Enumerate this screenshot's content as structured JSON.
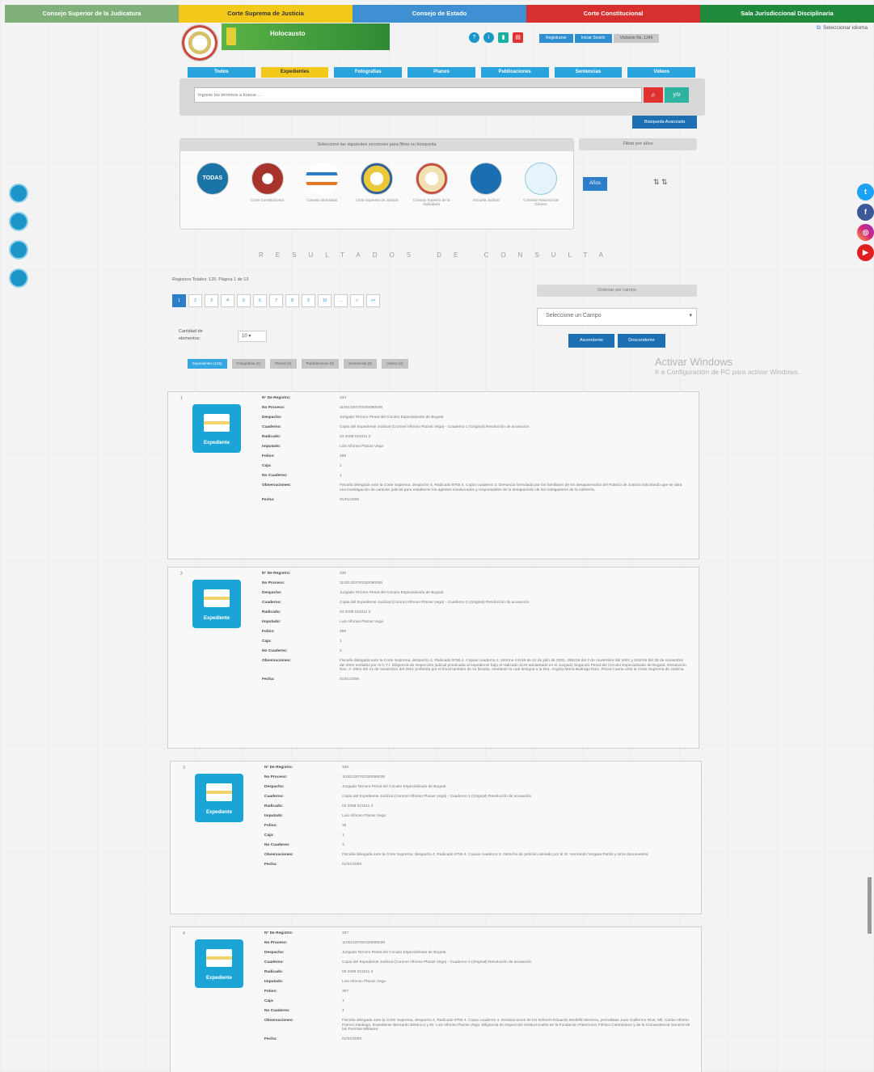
{
  "topbar": [
    {
      "label": "Consejo Superior de la Judicatura",
      "color": "#7fb07a"
    },
    {
      "label": "Corte Suprema de Justicia",
      "color": "#f2c81a",
      "text": "#333"
    },
    {
      "label": "Consejo de Estado",
      "color": "#3f8fd3"
    },
    {
      "label": "Corte Constitucional",
      "color": "#d8302e"
    },
    {
      "label": "Sala Jurisdiccional Disciplinaria",
      "color": "#1f8a3c"
    }
  ],
  "header": {
    "banner_title": "Holocausto",
    "buttons": [
      "Registrarse",
      "Iniciar Sesión"
    ],
    "visitor_count": "Visitante No. 1346",
    "language": "Seleccionar idioma"
  },
  "tabs": [
    "Todos",
    "Expedientes",
    "Fotografías",
    "Planos",
    "Publicaciones",
    "Sentencias",
    "Videos"
  ],
  "search": {
    "placeholder": "Ingrese los términos a buscar ...",
    "button_icon": "search-icon",
    "yo_label": "y/o",
    "advanced_label": "Búsqueda Avanzada"
  },
  "filters": {
    "corp_header": "Seleccione las siguientes secciones para filtrar su búsqueda",
    "corps": [
      {
        "label": "TODAS",
        "color": "#1a74a8"
      },
      {
        "label": "Corte Constitucional",
        "color": "#a8322c"
      },
      {
        "label": "Consejo de Estado",
        "color": "#e9eef5"
      },
      {
        "label": "Corte Suprema de Justicia",
        "color": "#e9c83a"
      },
      {
        "label": "Consejo Superior de la Judicatura",
        "color": "#f0e1b2"
      },
      {
        "label": "Escuela Judicial",
        "color": "#1a6fb2"
      },
      {
        "label": "Comisión Nacional de Género",
        "color": "#e6f3fa"
      }
    ],
    "years_header": "Filtrar por años",
    "years_button": "Años"
  },
  "social": [
    "twitter-icon",
    "facebook-icon",
    "instagram-icon",
    "youtube-icon"
  ],
  "results": {
    "title": "RESULTADOS DE CONSULTA",
    "totals": "Registros Totales: 125. Página 1 de 13",
    "pages": [
      "1",
      "2",
      "3",
      "4",
      "5",
      "6",
      "7",
      "8",
      "9",
      "10",
      "...",
      ">",
      ">>"
    ],
    "order_header": "Ordenar por campo",
    "order_select": "Seleccione un Campo",
    "asc": "Ascendente",
    "desc": "Descendente",
    "cantidad_label": "Cantidad de elementos:",
    "cantidad_value": "10",
    "result_tabs": [
      "Expedientes (125)",
      "Fotografías (0)",
      "Planos (0)",
      "Publicaciones (0)",
      "Sentencias (0)",
      "Videos (0)"
    ],
    "windows_line1": "Activar Windows",
    "windows_line2": "Ir a Configuración de PC para activar Windows.",
    "field_labels": [
      "N° De Registro:",
      "No Proceso:",
      "Despacho:",
      "Cuaderno:",
      "Radicado:",
      "Imputado:",
      "Folios:",
      "Caja:",
      "No Cuaderno:",
      "Observaciones:",
      "Fecha:"
    ],
    "icon_label": "Expediente",
    "items": [
      {
        "num": "1",
        "values": [
          "334",
          "11001320700320090039",
          "Juzgado Tercero Penal del Circuito Especializado de Bogotá",
          "Copia del Expediente Judicial (Coronel Alfonso Plazas Vega) - Cuaderno 1 (Original) Resolución de acusación",
          "03 2008 021011 3",
          "Luis Alfonso Plazas Vega",
          "299",
          "1",
          "1",
          "Fiscalía delegada ante la Corte Suprema, despacho 4, Radicado 9755 4. Copia cuaderno 3. Denuncia formulada por los familiares de los desaparecidos del Palacio de Justicia solicitando que se abra una investigación de carácter judicial para establecer los agentes involucrados y responsables de la desaparición de los trabajadores de la cafetería.",
          "01/01/2008"
        ]
      },
      {
        "num": "2",
        "values": [
          "335",
          "11001320700320090039",
          "Juzgado Tercero Penal del Circuito Especializado de Bogotá",
          "Copia del Expediente Judicial (Coronel Alfonso Plazas Vega) - Cuaderno 2 (Original) Resolución de acusación",
          "03 2008 021011 3",
          "Luis Alfonso Plazas Vega",
          "299",
          "1",
          "2",
          "Fiscalía delegada ante la Corte Suprema, despacho 4, Radicado 9755 4. Copias cuaderno 2. Informe 44438 de 24 de julio de 2001, 289126 del 2 de noviembre del 2001 y 202026 del 28 de noviembre del 2001 emitidos por el C.T.I. Diligencia de inspección judicial practicada al expediente bajo el radicado 1120 adelantado en el Juzgado Segundo Penal del Circuito Especializado de Bogotá. Resolución Nos. 3 -2001 del 21 de noviembre del 2001 proferida por el fiscal también de su fiscalía, mediante la cual designa a la Dra. Ángela María Buitrago Ruiz, Fiscal Cuarta ante la Corte Suprema de Justicia.",
          "01/01/2008"
        ]
      },
      {
        "num": "3",
        "values": [
          "336",
          "11001320700320090039",
          "Juzgado Tercero Penal del Circuito Especializado de Bogotá",
          "Copia del Expediente Judicial (Coronel Alfonso Plazas Vega) - Cuaderno 3 (Original) Resolución de acusación",
          "03 2008 021011 3",
          "Luis Alfonso Plazas Vega",
          "35",
          "1",
          "3",
          "Fiscalía delegada ante la Corte Suprema, despacho 4, Radicado 9755 4. Copias cuaderno 3. Derecho de petición elevado por el Sr. Hernando Vergara Pardo y otros documentos.",
          "01/01/2008"
        ]
      },
      {
        "num": "4",
        "values": [
          "337",
          "11001320700320090039",
          "Juzgado Tercero Penal del Circuito Especializado de Bogotá",
          "Copia del Expediente Judicial (Coronel Alfonso Plazas Vega) - Cuaderno 4 (Original) Resolución de acusación",
          "03 2008 021011 3",
          "Luis Alfonso Plazas Vega",
          "307",
          "1",
          "4",
          "Fiscalía delegada ante la Corte Suprema, despacho 4, Radicado 9755 4. Copia cuaderno 4. Declaraciones de los señores Eduardo Medellín Becerra, periodistas Juan Guillermo Ríos, Mil, Carlos Alberto Franco Santiago, Expediente Bernardo Betancur y Dr. Luis Alfonso Plazas Vega. Diligencia de inspección institucionales de la Fundación Patrimonio Fílmico Colombiano y de la Comandancia General de las Fuerzas Militares.",
          "01/01/2008"
        ]
      }
    ]
  }
}
